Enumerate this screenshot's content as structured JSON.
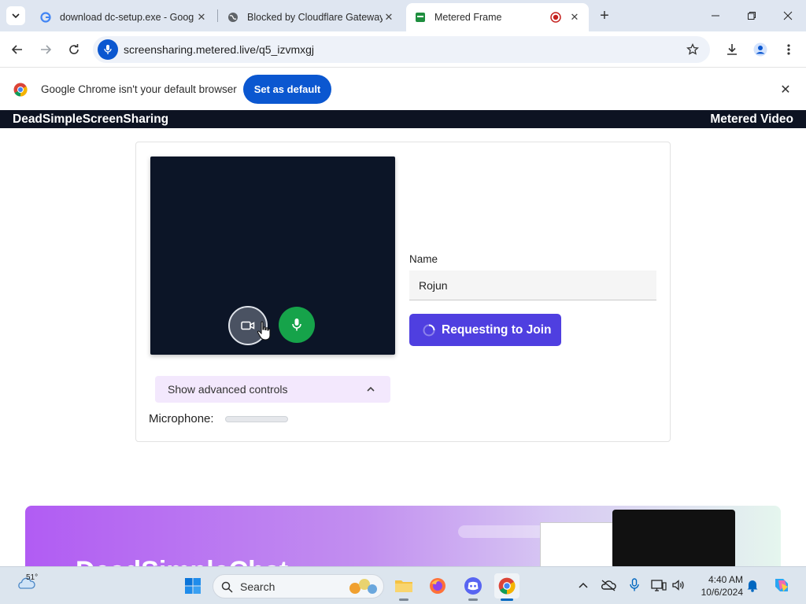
{
  "browser": {
    "tabs": [
      {
        "title": "download dc-setup.exe - Goog",
        "favicon": "google-icon"
      },
      {
        "title": "Blocked by Cloudflare Gateway",
        "favicon": "globe-icon"
      },
      {
        "title": "Metered Frame",
        "favicon": "metered-icon",
        "active": true
      }
    ],
    "address_url": "screensharing.metered.live/q5_izvmxgj",
    "infobar": {
      "message": "Google Chrome isn't your default browser",
      "button": "Set as default"
    }
  },
  "site": {
    "brand": "DeadSimpleScreenSharing",
    "right_brand": "Metered Video"
  },
  "join": {
    "name_label": "Name",
    "name_value": "Rojun",
    "button_label": "Requesting to Join",
    "advanced_label": "Show advanced controls",
    "microphone_label": "Microphone:",
    "microphone_level": 0
  },
  "promo": {
    "headline": "DeadSimpleChat"
  },
  "taskbar": {
    "temperature": "51°",
    "search_label": "Search",
    "time": "4:40 AM",
    "date": "10/6/2024"
  },
  "colors": {
    "accent_blue": "#0b57d0",
    "join_button": "#4f3fe0",
    "mic_green": "#16a34a",
    "video_bg": "#0c1527",
    "site_header": "#0d1322"
  }
}
